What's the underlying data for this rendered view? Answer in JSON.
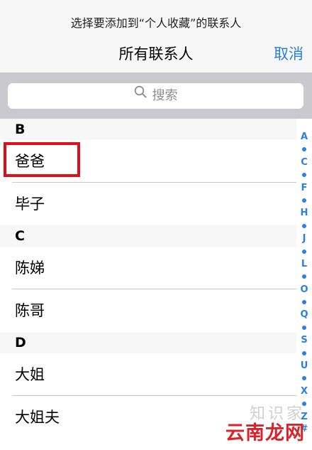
{
  "header": {
    "prompt": "选择要添加到“个人收藏”的联系人",
    "title": "所有联系人",
    "cancel_label": "取消"
  },
  "search": {
    "placeholder": "搜索",
    "icon": "magnifier-icon"
  },
  "sections": [
    {
      "letter": "B",
      "contacts": [
        "爸爸",
        "毕子"
      ]
    },
    {
      "letter": "C",
      "contacts": [
        "陈娣",
        "陈哥"
      ]
    },
    {
      "letter": "D",
      "contacts": [
        "大姐",
        "大姐夫"
      ]
    }
  ],
  "index_letters": [
    "A",
    "•",
    "C",
    "•",
    "F",
    "•",
    "H",
    "•",
    "J",
    "•",
    "L",
    "•",
    "O",
    "•",
    "Q",
    "•",
    "S",
    "•",
    "U",
    "•",
    "X",
    "•",
    "Z",
    "#"
  ],
  "highlight": {
    "contact": "爸爸",
    "color": "#e0101a"
  },
  "watermark": {
    "top": "知识家",
    "bottom": "云南龙网"
  },
  "colors": {
    "accent": "#2a7fe3",
    "highlight": "#e0101a"
  }
}
